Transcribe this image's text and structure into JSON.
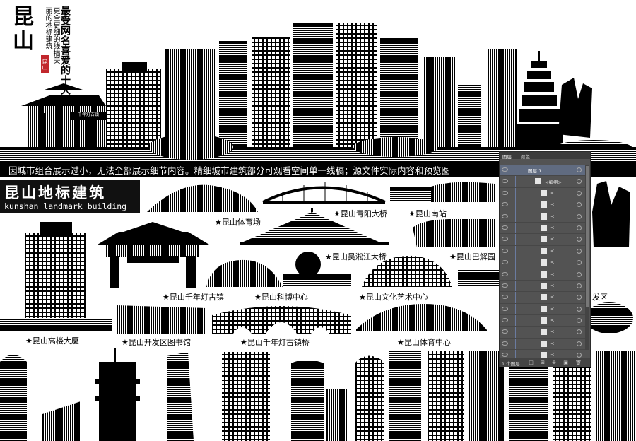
{
  "header": {
    "title": "昆山",
    "subtitle_main": "最受网名喜爱的十大城",
    "subtitle_side": "更全更细的线描美丽的地标建筑",
    "seal_text": "昆山"
  },
  "banner_text": "因城市组合展示过小，无法全部展示细节内容。精细城市建筑部分可观看空间单一线稿；源文件实际内容和预览图",
  "landmark_title": {
    "cn": "昆山地标建筑",
    "en": "kunshan landmark building"
  },
  "labels": {
    "gym": "★昆山体育场",
    "qingyang": "★昆山青阳大桥",
    "south_station": "★昆山南站",
    "wusong": "★昆山吴淞江大桥",
    "bajie": "★昆山巴解园",
    "lantern_town": "★昆山千年灯古镇",
    "science_museum": "★昆山科博中心",
    "culture_center": "★昆山文化艺术中心",
    "dev_zone": "发区",
    "gaolou": "★昆山高楼大厦",
    "library": "★昆山开发区图书馆",
    "bridge_town": "★昆山千年灯古镇桥",
    "sports_center": "★昆山体育中心"
  },
  "gate_sign": "千年灯古镇",
  "layers_panel": {
    "tabs": [
      "图层",
      "颜色"
    ],
    "top_layer": "图层 1",
    "group": "<编组>",
    "item_label": "<",
    "footer_count": "1 个图层"
  },
  "colors": {
    "ink": "#000000",
    "panel": "#535353",
    "seal": "#c1272d"
  }
}
